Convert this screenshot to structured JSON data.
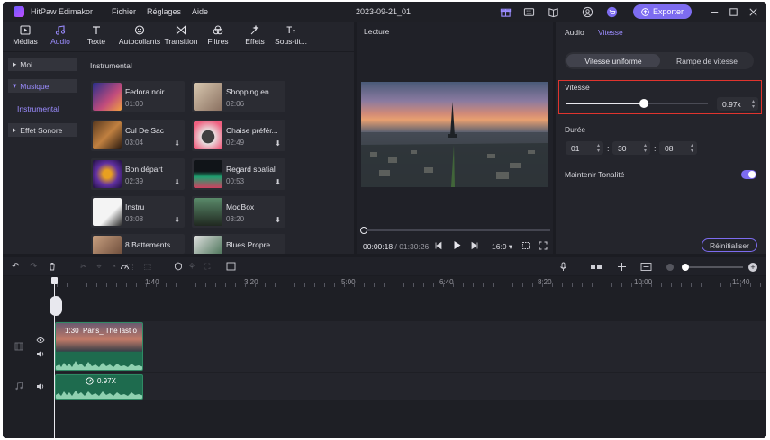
{
  "app": {
    "name": "HitPaw Edimakor",
    "menu": [
      "Fichier",
      "Réglages",
      "Aide"
    ],
    "project_title": "2023-09-21_01",
    "export_label": "Exporter"
  },
  "toolbar": {
    "items": [
      {
        "label": "Médias",
        "icon": "media-icon"
      },
      {
        "label": "Audio",
        "icon": "music-note-icon"
      },
      {
        "label": "Texte",
        "icon": "text-icon"
      },
      {
        "label": "Autocollants",
        "icon": "sticker-icon"
      },
      {
        "label": "Transition",
        "icon": "transition-icon"
      },
      {
        "label": "Filtres",
        "icon": "filter-icon"
      },
      {
        "label": "Effets",
        "icon": "effects-icon"
      },
      {
        "label": "Sous-tit...",
        "icon": "subtitle-icon"
      }
    ],
    "active": "Audio"
  },
  "library": {
    "categories": [
      "Moi",
      "Musique",
      "Instrumental",
      "Effet Sonore"
    ],
    "section_title": "Instrumental",
    "tracks": [
      {
        "name": "Fedora noir",
        "duration": "01:00"
      },
      {
        "name": "Shopping en ...",
        "duration": "02:06"
      },
      {
        "name": "Cul De Sac",
        "duration": "03:04"
      },
      {
        "name": "Chaise préfér...",
        "duration": "02:49"
      },
      {
        "name": "Bon départ",
        "duration": "02:39"
      },
      {
        "name": "Regard spatial",
        "duration": "00:53"
      },
      {
        "name": "Instru",
        "duration": "03:08"
      },
      {
        "name": "ModBox",
        "duration": "03:20"
      },
      {
        "name": "8 Battements",
        "duration": ""
      },
      {
        "name": "Blues Propre",
        "duration": ""
      }
    ]
  },
  "player": {
    "title": "Lecture",
    "current_time": "00:00:18",
    "total_time": "/ 01:30:26",
    "aspect": "16:9",
    "progress": 0.0
  },
  "speed_panel": {
    "tabs": [
      "Audio",
      "Vitesse"
    ],
    "active_tab": "Vitesse",
    "modes": [
      "Vitesse uniforme",
      "Rampe de vitesse"
    ],
    "active_mode": "Vitesse uniforme",
    "speed_label": "Vitesse",
    "speed_value": "0.97x",
    "speed_fraction": 0.55,
    "duration_label": "Durée",
    "duration": {
      "h": "01",
      "m": "30",
      "s": "08"
    },
    "keep_pitch_label": "Maintenir Tonalité",
    "keep_pitch": true,
    "reset_label": "Réinitialiser",
    "highlight_color": "#e0342e"
  },
  "timeline": {
    "ruler": [
      "1:40",
      "3:20",
      "5:00",
      "6:40",
      "8:20",
      "10:00",
      "11:40"
    ],
    "video_clip": {
      "duration": "1:30",
      "title": "Paris_ The last o"
    },
    "audio_clip": {
      "speed": "0.97X"
    }
  },
  "colors": {
    "accent": "#7d6cf0",
    "clip_green": "#1e6b4e",
    "background": "#1b1c22"
  }
}
